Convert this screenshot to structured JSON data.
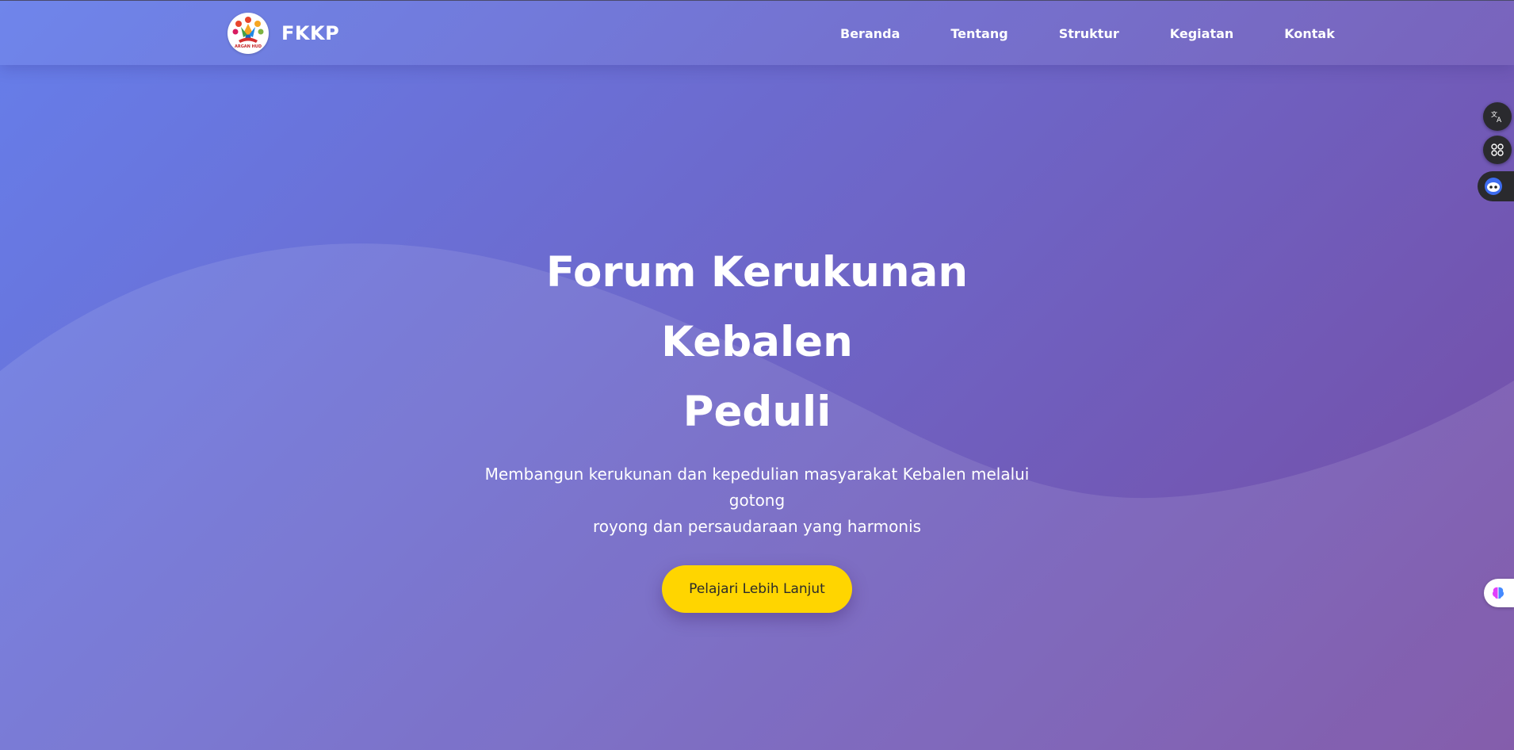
{
  "header": {
    "brand_name": "FKKP",
    "logo_icon": "community-logo-icon",
    "logo_text": "ARGAN HUD"
  },
  "nav": {
    "items": [
      {
        "label": "Beranda"
      },
      {
        "label": "Tentang"
      },
      {
        "label": "Struktur"
      },
      {
        "label": "Kegiatan"
      },
      {
        "label": "Kontak"
      }
    ]
  },
  "hero": {
    "title_line1": "Forum Kerukunan Kebalen",
    "title_line2": "Peduli",
    "subtitle_line1": "Membangun kerukunan dan kepedulian masyarakat Kebalen melalui gotong",
    "subtitle_line2": "royong dan persaudaraan yang harmonis",
    "cta_label": "Pelajari Lebih Lanjut"
  },
  "side_tools": {
    "icons": [
      "translate-icon",
      "apps-grid-icon",
      "assistant-bot-icon",
      "brain-icon"
    ]
  },
  "colors": {
    "gradient_start": "#667eea",
    "gradient_end": "#764ba2",
    "cta_background": "#ffd500",
    "text": "#ffffff"
  }
}
